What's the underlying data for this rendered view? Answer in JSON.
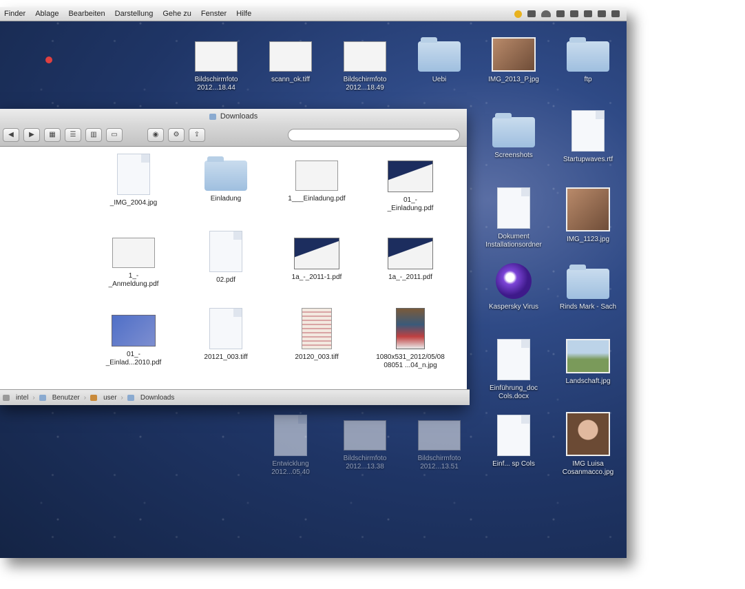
{
  "menubar": {
    "items": [
      "Finder",
      "Ablage",
      "Bearbeiten",
      "Darstellung",
      "Gehe zu",
      "Fenster",
      "Hilfe"
    ],
    "right_icons": [
      "sun-icon",
      "bluetooth-icon",
      "wifi-icon",
      "volume-icon",
      "battery-icon",
      "clock-icon",
      "user-icon",
      "search-icon"
    ]
  },
  "desktop": {
    "icons": [
      {
        "label": "Bildschirmfoto 2012...18.44",
        "kind": "thumb"
      },
      {
        "label": "scann_ok.tiff",
        "kind": "thumb"
      },
      {
        "label": "Bildschirmfoto 2012...18.49",
        "kind": "thumb"
      },
      {
        "label": "Uebi",
        "kind": "folder"
      },
      {
        "label": "IMG_2013_P.jpg",
        "kind": "photo"
      },
      {
        "label": "ftp",
        "kind": "folder"
      },
      {
        "label": "Screenshots",
        "kind": "folder"
      },
      {
        "label": "Startupwaves.rtf",
        "kind": "doc"
      },
      {
        "label": "Dokument Installationsordner",
        "kind": "doc"
      },
      {
        "label": "IMG_1123.jpg",
        "kind": "photo"
      },
      {
        "label": "Kaspersky Virus",
        "kind": "purple"
      },
      {
        "label": "Rinds Mark - Sach",
        "kind": "folder"
      },
      {
        "label": "Einführung_doc Cols.docx",
        "kind": "doc"
      },
      {
        "label": "Landschaft.jpg",
        "kind": "land"
      },
      {
        "label": "Entwicklung 2012...05.40",
        "kind": "doc"
      },
      {
        "label": "Bildschirmfoto 2012...13.38",
        "kind": "thumb"
      },
      {
        "label": "Bildschirmfoto 2012...13.51",
        "kind": "thumb"
      },
      {
        "label": "Einf... sp Cols",
        "kind": "doc"
      },
      {
        "label": "IMG Luisa Cosanmacco.jpg",
        "kind": "face"
      }
    ]
  },
  "finder": {
    "title": "Downloads",
    "search_placeholder": "",
    "toolbar": [
      "back",
      "forward",
      "icon-view",
      "list-view",
      "column-view",
      "cover-flow",
      "quicklook",
      "action",
      "share"
    ],
    "files": [
      {
        "label": "_IMG_2004.jpg",
        "kind": "doc"
      },
      {
        "label": "Einladung",
        "kind": "folder"
      },
      {
        "label": "1___Einladung.pdf",
        "kind": "thumb"
      },
      {
        "label": "01_-\n_Einladung.pdf",
        "kind": "pdf"
      },
      {
        "label": "1_-\n_Anmeldung.pdf",
        "kind": "thumb"
      },
      {
        "label": "02.pdf",
        "kind": "doc"
      },
      {
        "label": "1a_-_2011-1.pdf",
        "kind": "pdf"
      },
      {
        "label": "1a_-_2011.pdf",
        "kind": "pdf"
      },
      {
        "label": "01_-\n_Einlad...2010.pdf",
        "kind": "blue"
      },
      {
        "label": "20121_003.tiff",
        "kind": "doc"
      },
      {
        "label": "20120_003.tiff",
        "kind": "news"
      },
      {
        "label": "1080x531_2012/05/08\n08051 ...04_n.jpg",
        "kind": "colorful"
      }
    ],
    "path": [
      "intel",
      "Benutzer",
      "user",
      "Downloads"
    ]
  }
}
